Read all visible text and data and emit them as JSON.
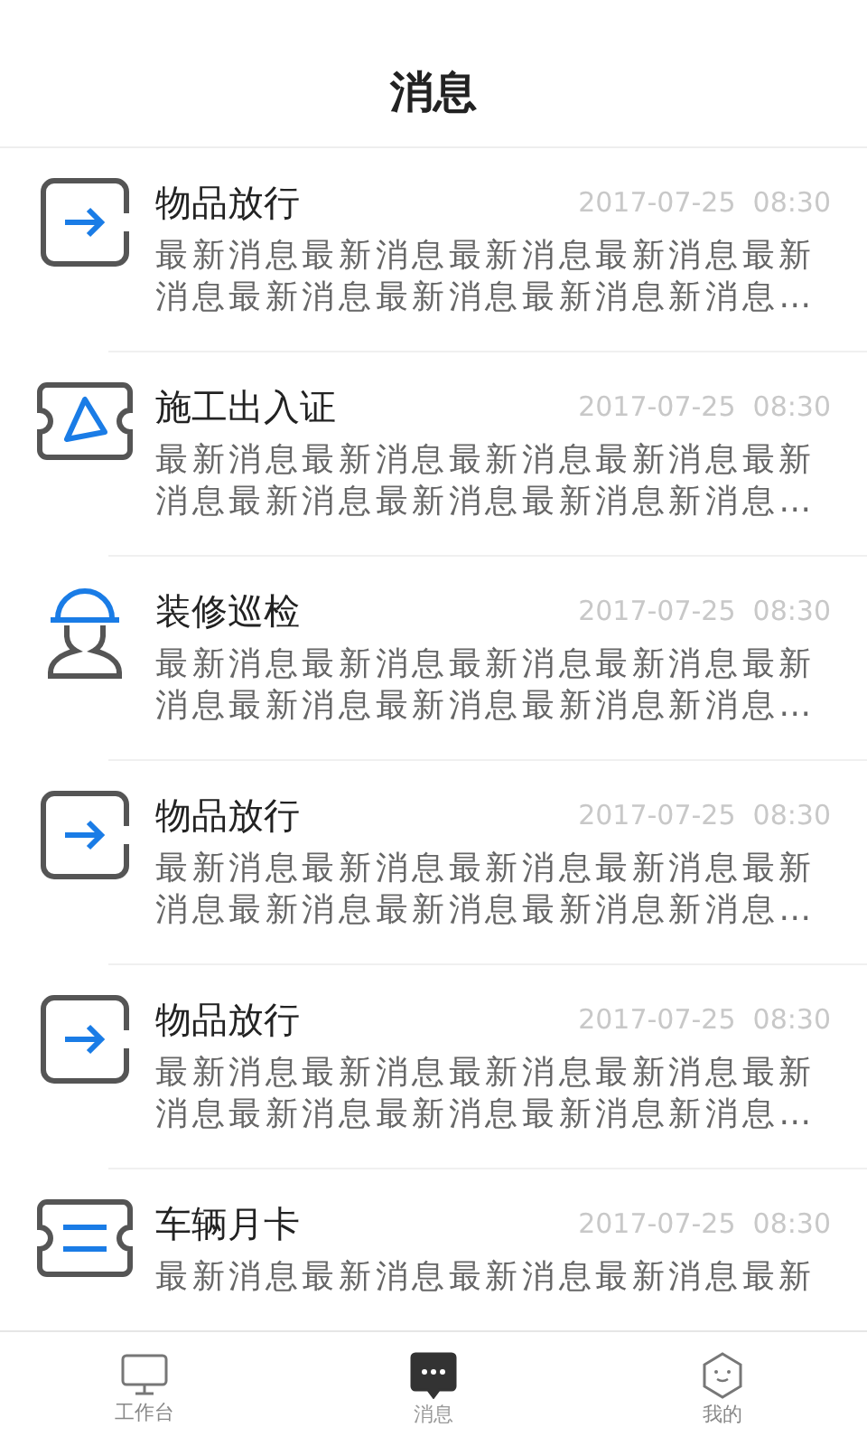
{
  "header": {
    "title": "消息"
  },
  "messages": [
    {
      "kind": "release",
      "title": "物品放行",
      "time": "2017-07-25  08:30",
      "preview": "最新消息最新消息最新消息最新消息最新消息最新消息最新消息最新消息新消息…"
    },
    {
      "kind": "permit",
      "title": "施工出入证",
      "time": "2017-07-25  08:30",
      "preview": "最新消息最新消息最新消息最新消息最新消息最新消息最新消息最新消息新消息…"
    },
    {
      "kind": "inspection",
      "title": "装修巡检",
      "time": "2017-07-25  08:30",
      "preview": "最新消息最新消息最新消息最新消息最新消息最新消息最新消息最新消息新消息…"
    },
    {
      "kind": "release",
      "title": "物品放行",
      "time": "2017-07-25  08:30",
      "preview": "最新消息最新消息最新消息最新消息最新消息最新消息最新消息最新消息新消息…"
    },
    {
      "kind": "release",
      "title": "物品放行",
      "time": "2017-07-25  08:30",
      "preview": "最新消息最新消息最新消息最新消息最新消息最新消息最新消息最新消息新消息…"
    },
    {
      "kind": "card",
      "title": "车辆月卡",
      "time": "2017-07-25  08:30",
      "preview": "最新消息最新消息最新消息最新消息最新"
    }
  ],
  "tab_bar": [
    {
      "kind": "workbench",
      "label": "工作台",
      "selected": false
    },
    {
      "kind": "messages",
      "label": "消息",
      "selected": true
    },
    {
      "kind": "profile",
      "label": "我的",
      "selected": false
    }
  ]
}
